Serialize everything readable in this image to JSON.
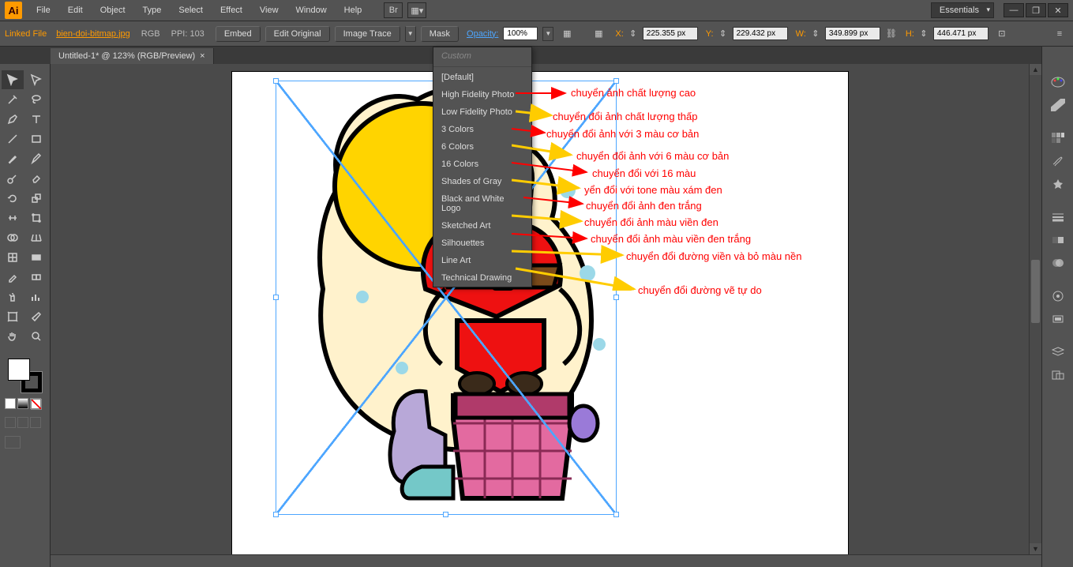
{
  "app": {
    "logo": "Ai"
  },
  "menubar": [
    "File",
    "Edit",
    "Object",
    "Type",
    "Select",
    "Effect",
    "View",
    "Window",
    "Help"
  ],
  "workspace": "Essentials",
  "controlbar": {
    "linked": "Linked File",
    "filename": "bien-doi-bitmap.jpg",
    "colormode": "RGB",
    "ppi": "PPI: 103",
    "embed": "Embed",
    "editOriginal": "Edit Original",
    "imageTrace": "Image Trace",
    "mask": "Mask",
    "opacityLabel": "Opacity:",
    "opacityValue": "100%",
    "xLabel": "X:",
    "xValue": "225.355 px",
    "yLabel": "Y:",
    "yValue": "229.432 px",
    "wLabel": "W:",
    "wValue": "349.899 px",
    "hLabel": "H:",
    "hValue": "446.471 px"
  },
  "tab": {
    "title": "Untitled-1* @ 123% (RGB/Preview)"
  },
  "dropdown": {
    "custom": "Custom",
    "items": [
      "[Default]",
      "High Fidelity Photo",
      "Low Fidelity Photo",
      "3 Colors",
      "6 Colors",
      "16 Colors",
      "Shades of Gray",
      "Black and White Logo",
      "Sketched Art",
      "Silhouettes",
      "Line Art",
      "Technical Drawing"
    ]
  },
  "annotations": [
    "chuyển ảnh chất lượng cao",
    "chuyển đổi ảnh chất lượng thấp",
    "chuyển đổi ảnh với 3 màu cơ bản",
    "chuyển đổi ảnh với 6 màu cơ bản",
    "chuyển đổi với 16 màu",
    "yển đổi với tone màu xám đen",
    "chuyển đổi ảnh đen trắng",
    "chuyển đổi ảnh màu viền đen",
    "chuyển đổi ảnh màu viền đen trắng",
    "chuyển đổi đường viền và bỏ màu nền",
    "chuyển đổi đường vẽ tự do"
  ]
}
